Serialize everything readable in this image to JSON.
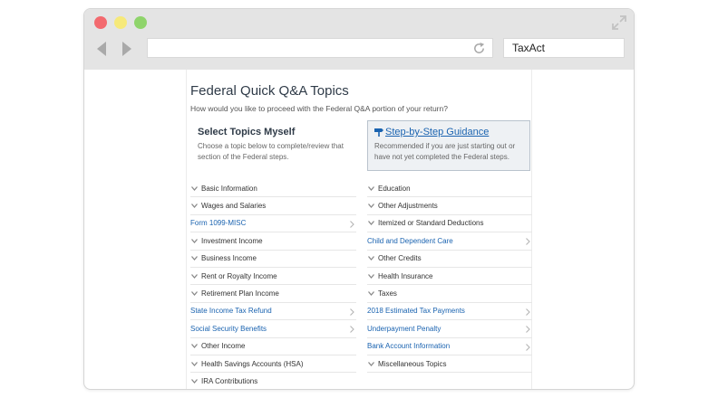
{
  "browser": {
    "search_text": "TaxAct"
  },
  "page": {
    "title": "Federal Quick Q&A Topics",
    "subtitle": "How would you like to proceed with the Federal Q&A portion of your return?",
    "self_option": {
      "title": "Select Topics Myself",
      "desc_line1": "Choose a topic below to complete/review that",
      "desc_line2": "section of the Federal steps."
    },
    "guided_option": {
      "title": "Step-by-Step Guidance",
      "desc_line1": "Recommended if you are just starting out or",
      "desc_line2": "have not yet completed the Federal steps."
    }
  },
  "topics_left": [
    {
      "label": "Basic Information",
      "type": "expand"
    },
    {
      "label": "Wages and Salaries",
      "type": "expand"
    },
    {
      "label": "Form 1099-MISC",
      "type": "link"
    },
    {
      "label": "Investment Income",
      "type": "expand"
    },
    {
      "label": "Business Income",
      "type": "expand"
    },
    {
      "label": "Rent or Royalty Income",
      "type": "expand"
    },
    {
      "label": "Retirement Plan Income",
      "type": "expand"
    },
    {
      "label": "State Income Tax Refund",
      "type": "link"
    },
    {
      "label": "Social Security Benefits",
      "type": "link"
    },
    {
      "label": "Other Income",
      "type": "expand"
    },
    {
      "label": "Health Savings Accounts (HSA)",
      "type": "expand"
    },
    {
      "label": "IRA Contributions",
      "type": "expand"
    }
  ],
  "topics_right": [
    {
      "label": "Education",
      "type": "expand"
    },
    {
      "label": "Other Adjustments",
      "type": "expand"
    },
    {
      "label": "Itemized or Standard Deductions",
      "type": "expand"
    },
    {
      "label": "Child and Dependent Care",
      "type": "link"
    },
    {
      "label": "Other Credits",
      "type": "expand"
    },
    {
      "label": "Health Insurance",
      "type": "expand"
    },
    {
      "label": "Taxes",
      "type": "expand"
    },
    {
      "label": "2018 Estimated Tax Payments",
      "type": "link"
    },
    {
      "label": "Underpayment Penalty",
      "type": "link"
    },
    {
      "label": "Bank Account Information",
      "type": "link"
    },
    {
      "label": "Miscellaneous Topics",
      "type": "expand"
    }
  ],
  "colors": {
    "link": "#1a63b0",
    "heading": "#2f3b48",
    "chrome": "#e4e4e4"
  },
  "icons": {
    "expand": "chevron-down-icon",
    "link": "chevron-right-icon"
  }
}
